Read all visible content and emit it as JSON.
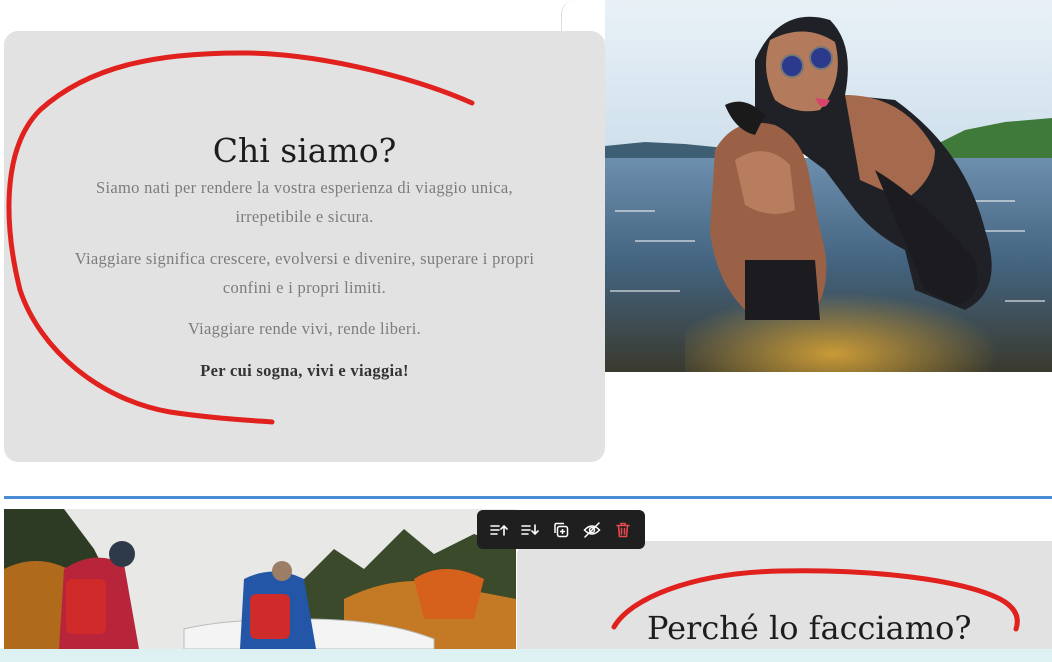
{
  "about": {
    "title": "Chi siamo?",
    "paragraphs": [
      "Siamo nati per rendere la vostra esperienza di viaggio unica, irrepetibile e sicura.",
      "Viaggiare significa crescere, evolversi e divenire, superare i propri confini e i propri limiti.",
      "Viaggiare rende vivi, rende liberi."
    ],
    "tagline": "Per cui sogna, vivi e viaggia!"
  },
  "why": {
    "title": "Perché lo facciamo?"
  },
  "toolbar": {
    "buttons": [
      "move-up-icon",
      "move-down-icon",
      "duplicate-icon",
      "hide-icon",
      "delete-icon"
    ]
  },
  "colors": {
    "accent": "#4a8bd6",
    "annotation": "#e0211d",
    "card": "#e2e2e2",
    "delete": "#e5484d"
  }
}
